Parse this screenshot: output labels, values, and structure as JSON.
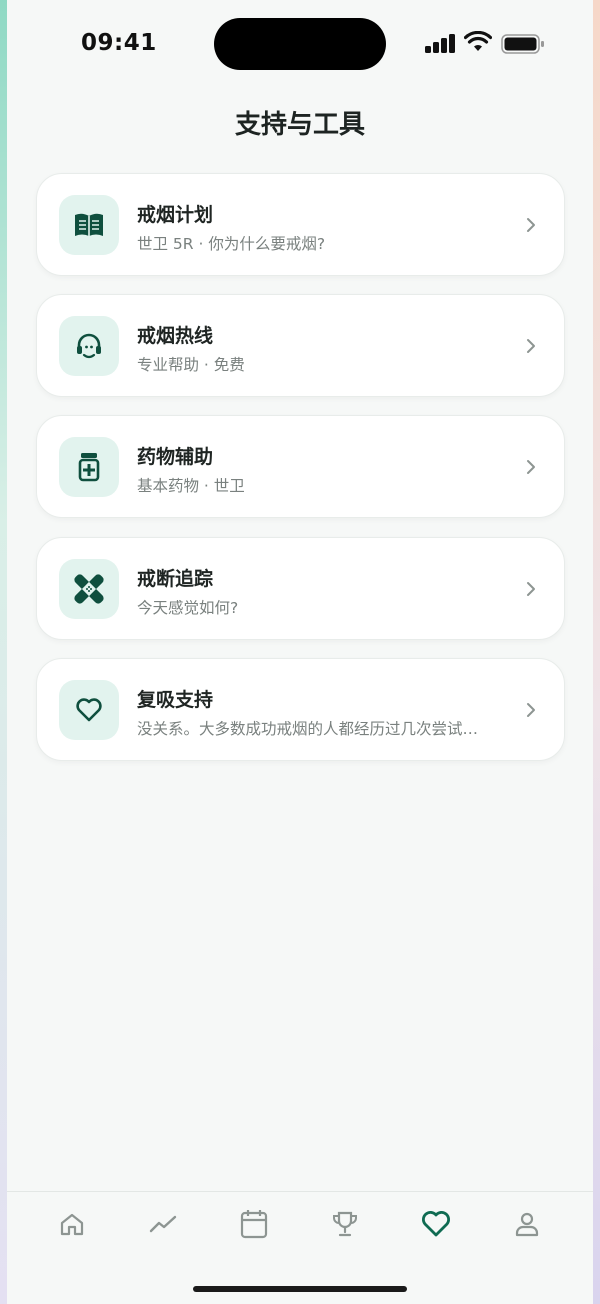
{
  "status_bar": {
    "time": "09:41"
  },
  "page": {
    "title": "支持与工具"
  },
  "cards": [
    {
      "title": "戒烟计划",
      "subtitle": "世卫 5R · 你为什么要戒烟?",
      "icon": "book-icon"
    },
    {
      "title": "戒烟热线",
      "subtitle": "专业帮助 · 免费",
      "icon": "headset-icon"
    },
    {
      "title": "药物辅助",
      "subtitle": "基本药物 · 世卫",
      "icon": "medicine-bottle-icon"
    },
    {
      "title": "戒断追踪",
      "subtitle": "今天感觉如何?",
      "icon": "bandage-icon"
    },
    {
      "title": "复吸支持",
      "subtitle": "没关系。大多数成功戒烟的人都经历过几次尝试…",
      "icon": "heart-icon"
    }
  ],
  "tab_bar": {
    "tabs": [
      "home-icon",
      "trend-icon",
      "calendar-icon",
      "trophy-icon",
      "heart-icon",
      "profile-icon"
    ],
    "active_tab": "heart-icon"
  },
  "colors": {
    "accent": "#0f6b52",
    "icon_bg": "#e2f3ee",
    "inactive_tab": "#8d9592"
  }
}
